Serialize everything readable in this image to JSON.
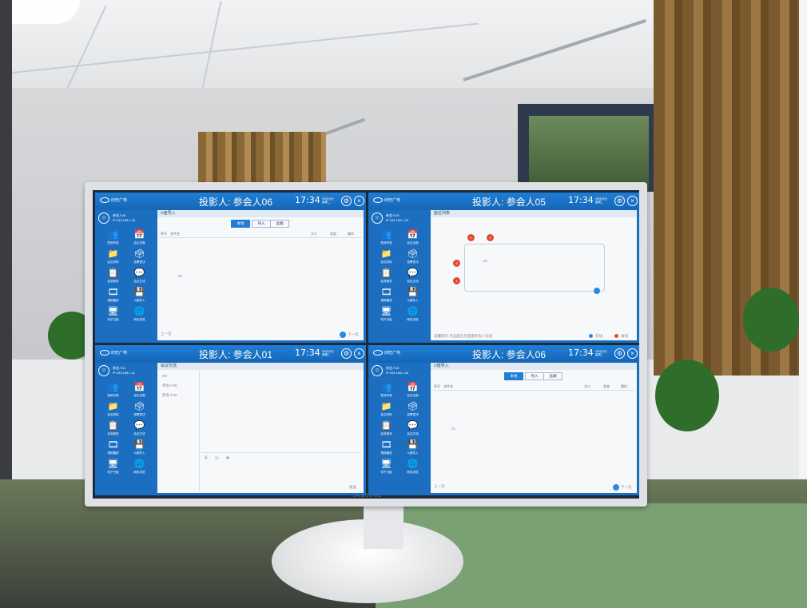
{
  "monitor": {
    "brand": "SAMSUNG"
  },
  "panes": [
    {
      "projector": "投影人: 参会人06",
      "time": "17:34",
      "date": "09月29日 星期二",
      "logo": "欣旺广电",
      "user_name": "参会人06",
      "user_ip": "IP:192.168.1.16",
      "content_title": "U盘导入",
      "tabs": [
        "本地",
        "导入",
        "远端"
      ],
      "columns": [
        "序号",
        "文件名",
        "大小",
        "状态",
        "操作"
      ],
      "footer_left": "上一页",
      "footer_right": "下一页",
      "note": "01"
    },
    {
      "projector": "投影人: 参会人05",
      "time": "17:34",
      "date": "09月29日 星期二",
      "logo": "欣旺广电",
      "user_name": "参会人05",
      "user_ip": "IP:192.168.1.15",
      "content_title": "座位列表",
      "seats": [
        "1",
        "2",
        "3",
        "4"
      ],
      "table_label": "01",
      "footer_left": "温馨提示:点击座位可查看参会人信息",
      "legend": [
        "在线",
        "离线"
      ]
    },
    {
      "projector": "投影人: 参会人01",
      "time": "17:34",
      "date": "09月29日 星期二",
      "logo": "欣旺广电",
      "user_name": "参会人01",
      "user_ip": "IP:192.168.1.11",
      "content_title": "会议交流",
      "list": [
        "0/2",
        "参会人05",
        "参会人06"
      ],
      "footer_right": "发送"
    },
    {
      "projector": "投影人: 参会人06",
      "time": "17:34",
      "date": "09月29日 星期二",
      "logo": "欣旺广电",
      "user_name": "参会人06",
      "user_ip": "IP:192.168.1.16",
      "content_title": "U盘导入",
      "tabs": [
        "本地",
        "导入",
        "远端"
      ],
      "columns": [
        "序号",
        "文件名",
        "大小",
        "状态",
        "操作"
      ],
      "footer_left": "上一页",
      "footer_right": "下一页",
      "note": "01"
    }
  ],
  "menu": [
    {
      "icon": "👥",
      "label": "签到列表"
    },
    {
      "icon": "📅",
      "label": "会议议程"
    },
    {
      "icon": "📁",
      "label": "会议资料"
    },
    {
      "icon": "🗳",
      "label": "投票表决"
    },
    {
      "icon": "📋",
      "label": "会务服务"
    },
    {
      "icon": "💬",
      "label": "会议交流"
    },
    {
      "icon": "🎞",
      "label": "视频播放"
    },
    {
      "icon": "💾",
      "label": "U盘导入"
    },
    {
      "icon": "🖥",
      "label": "电子白板"
    },
    {
      "icon": "🌐",
      "label": "网页浏览"
    }
  ]
}
